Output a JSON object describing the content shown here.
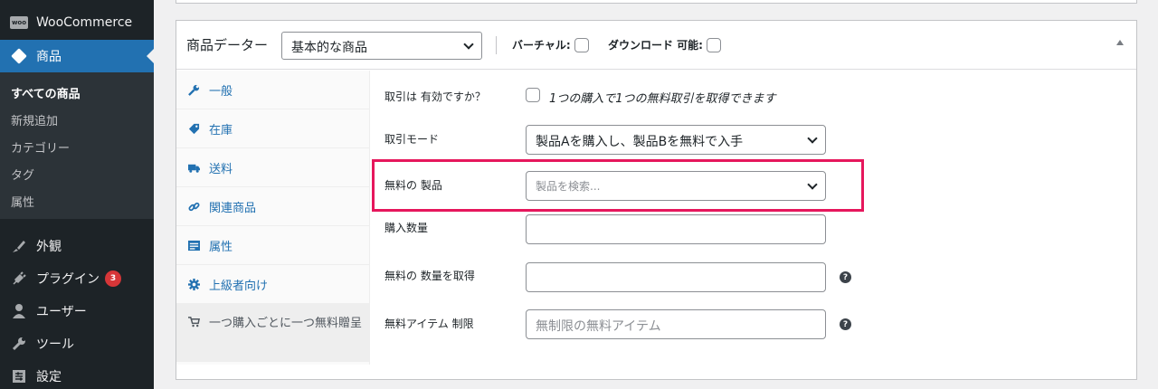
{
  "sidebar": {
    "woocommerce": "WooCommerce",
    "woo_logo_text": "woo",
    "products": "商品",
    "submenu": [
      "すべての商品",
      "新規追加",
      "カテゴリー",
      "タグ",
      "属性"
    ],
    "appearance": "外観",
    "plugins": "プラグイン",
    "plugins_badge": "3",
    "users": "ユーザー",
    "tools": "ツール",
    "settings": "設定"
  },
  "product_data": {
    "title": "商品データー",
    "type_selected": "基本的な商品",
    "virtual_label": "バーチャル:",
    "download_label": "ダウンロード 可能:"
  },
  "tabs": [
    "一般",
    "在庫",
    "送料",
    "関連商品",
    "属性",
    "上級者向け",
    "一つ購入ごとに一つ無料贈呈"
  ],
  "fields": {
    "discount_enabled_label": "取引は 有効ですか？",
    "discount_enabled_text": "1つの購入で1つの無料取引を取得できます",
    "deal_mode_label": "取引モード",
    "deal_mode_value": "製品Aを購入し、製品Bを無料で入手",
    "free_product_label": "無料の 製品",
    "free_product_placeholder": "製品を検索...",
    "purchase_qty_label": "購入数量",
    "purchase_qty_value": "",
    "free_qty_label": "無料の 数量を取得",
    "free_qty_value": "",
    "free_limit_label": "無料アイテム 制限",
    "free_limit_placeholder": "無制限の無料アイテム",
    "help_glyph": "?"
  }
}
